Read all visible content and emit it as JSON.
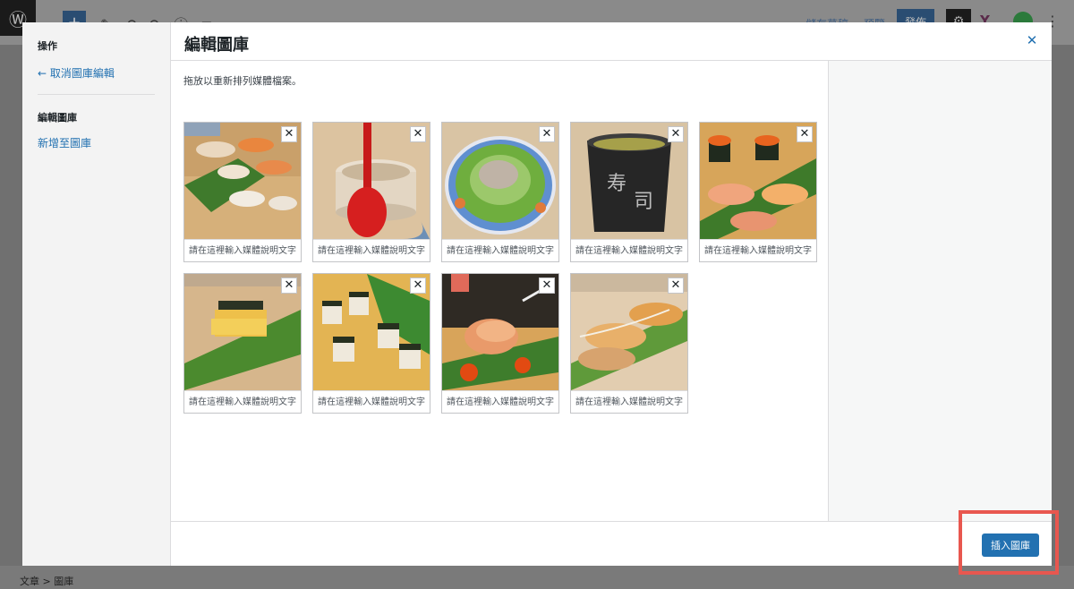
{
  "background": {
    "publish_label": "發佈",
    "save_label": "儲存草稿",
    "preview_label": "預覽",
    "breadcrumb": "文章 > 圖庫"
  },
  "sidebar": {
    "heading": "操作",
    "cancel_link": "← 取消圖庫編輯",
    "section_title": "編輯圖庫",
    "add_link": "新增至圖庫"
  },
  "modal": {
    "title": "編輯圖庫",
    "instruction": "拖放以重新排列媒體檔案。",
    "insert_button": "插入圖庫"
  },
  "gallery": {
    "caption_placeholder": "請在這裡輸入媒體說明文字",
    "items": [
      {
        "name": "sushi-platter"
      },
      {
        "name": "chawanmushi-spoon"
      },
      {
        "name": "salad-bowl"
      },
      {
        "name": "green-tea-cup"
      },
      {
        "name": "salmon-roe-sushi"
      },
      {
        "name": "tamago-sushi"
      },
      {
        "name": "pressed-sushi"
      },
      {
        "name": "aburi-salmon"
      },
      {
        "name": "seared-sushi"
      }
    ]
  },
  "colors": {
    "accent": "#2271b1",
    "highlight_border": "#e8574f"
  }
}
